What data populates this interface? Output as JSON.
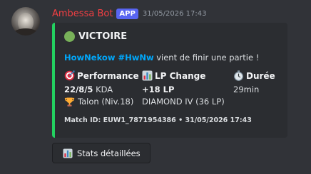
{
  "message": {
    "author": "Ambessa Bot",
    "app_tag": "APP",
    "timestamp": "31/05/2026 17:43"
  },
  "embed": {
    "accent_color": "#23d160",
    "title": "VICTOIRE",
    "title_icon": "green-circle-icon",
    "description": {
      "player": "HowNekow #HwNw",
      "text": " vient de finir une partie !"
    },
    "fields": [
      {
        "icon": "target-icon",
        "name": "Performance",
        "line1_bold": "22/8/5",
        "line1_rest": " KDA",
        "line2_icon": "trophy-icon",
        "line2": "Talon (Niv.18)"
      },
      {
        "icon": "bar-chart-icon",
        "name": "LP Change",
        "line1_bold": "+18 LP",
        "line2": "DIAMOND IV (36 LP)"
      },
      {
        "icon": "stopwatch-icon",
        "name": "Durée",
        "line1": "29min"
      }
    ],
    "footer": "Match ID: EUW1_7871954386 • 31/05/2026 17:43"
  },
  "button": {
    "icon": "bar-chart-icon",
    "label": "Stats détaillées"
  }
}
